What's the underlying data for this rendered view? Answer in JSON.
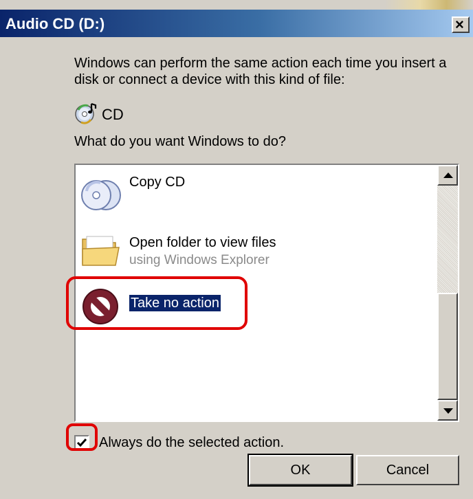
{
  "window": {
    "title": "Audio CD (D:)",
    "close_glyph": "×"
  },
  "intro_text": "Windows can perform the same action each time you insert a disk or connect a device with this kind of file:",
  "content_type": {
    "icon": "cd-music-icon",
    "label": "CD"
  },
  "question": "What do you want Windows to do?",
  "actions": [
    {
      "icon": "copy-cd-icon",
      "title": "Copy CD",
      "subtitle": ""
    },
    {
      "icon": "folder-icon",
      "title": "Open folder to view files",
      "subtitle": "using Windows Explorer"
    },
    {
      "icon": "no-action-icon",
      "title": "Take no action",
      "subtitle": "",
      "selected": true
    }
  ],
  "always_checkbox": {
    "label": "Always do the selected action.",
    "checked": true,
    "check_glyph": "✔"
  },
  "buttons": {
    "ok": "OK",
    "cancel": "Cancel"
  },
  "colors": {
    "title_bar_start": "#0a246a",
    "selection": "#0a246a",
    "annotation": "#e00000",
    "dialog_face": "#d4d0c8"
  }
}
